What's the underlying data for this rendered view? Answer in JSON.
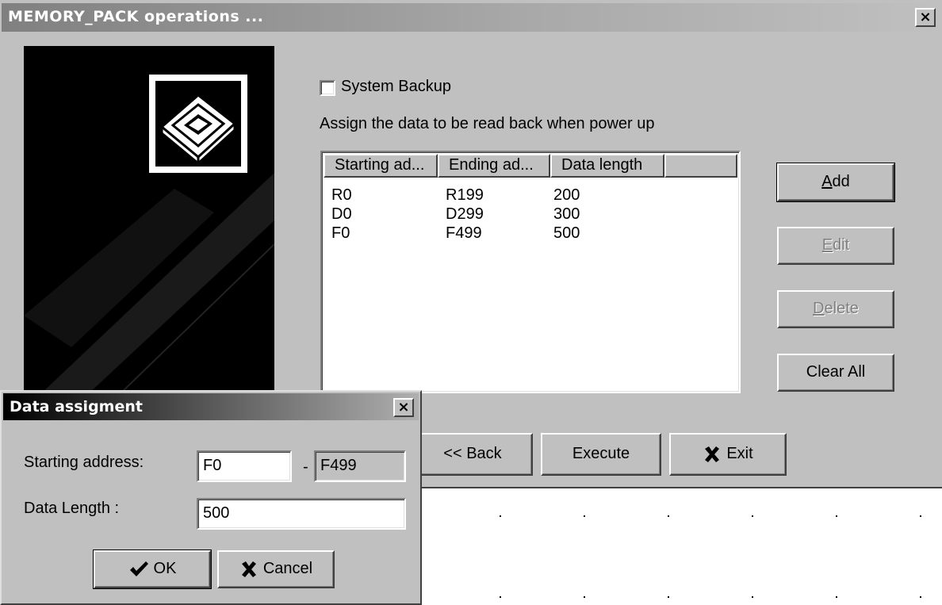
{
  "main_dialog": {
    "title": "MEMORY_PACK operations ...",
    "close_glyph": "×",
    "system_backup_label": "System Backup",
    "system_backup_checked": false,
    "assign_text": "Assign the data to be read back when power up",
    "columns": [
      "Starting ad...",
      "Ending ad...",
      "Data length",
      ""
    ],
    "rows": [
      {
        "start": "R0",
        "end": "R199",
        "length": "200"
      },
      {
        "start": "D0",
        "end": "D299",
        "length": "300"
      },
      {
        "start": "F0",
        "end": "F499",
        "length": "500"
      }
    ],
    "buttons": {
      "add": {
        "accel": "A",
        "rest": "dd"
      },
      "edit": {
        "accel": "E",
        "rest": "dit"
      },
      "delete": {
        "accel": "D",
        "rest": "elete"
      },
      "clear_all": "Clear All",
      "back": "<< Back",
      "execute": "Execute",
      "exit": "Exit"
    },
    "icons": {
      "side_image": "memory-pack-icon",
      "exit": "x-icon"
    }
  },
  "assign_dialog": {
    "title": "Data assigment",
    "close_glyph": "×",
    "starting_address_label": "Starting address:",
    "start_value": "F0",
    "separator": "-",
    "end_value": "F499",
    "data_length_label": "Data Length :",
    "length_value": "500",
    "ok_label": "OK",
    "cancel_label": "Cancel",
    "icons": {
      "ok": "checkmark-icon",
      "cancel": "x-icon"
    }
  },
  "colors": {
    "face": "#c0c0c0",
    "title_active": "#000000",
    "title_inactive": "#808080"
  }
}
